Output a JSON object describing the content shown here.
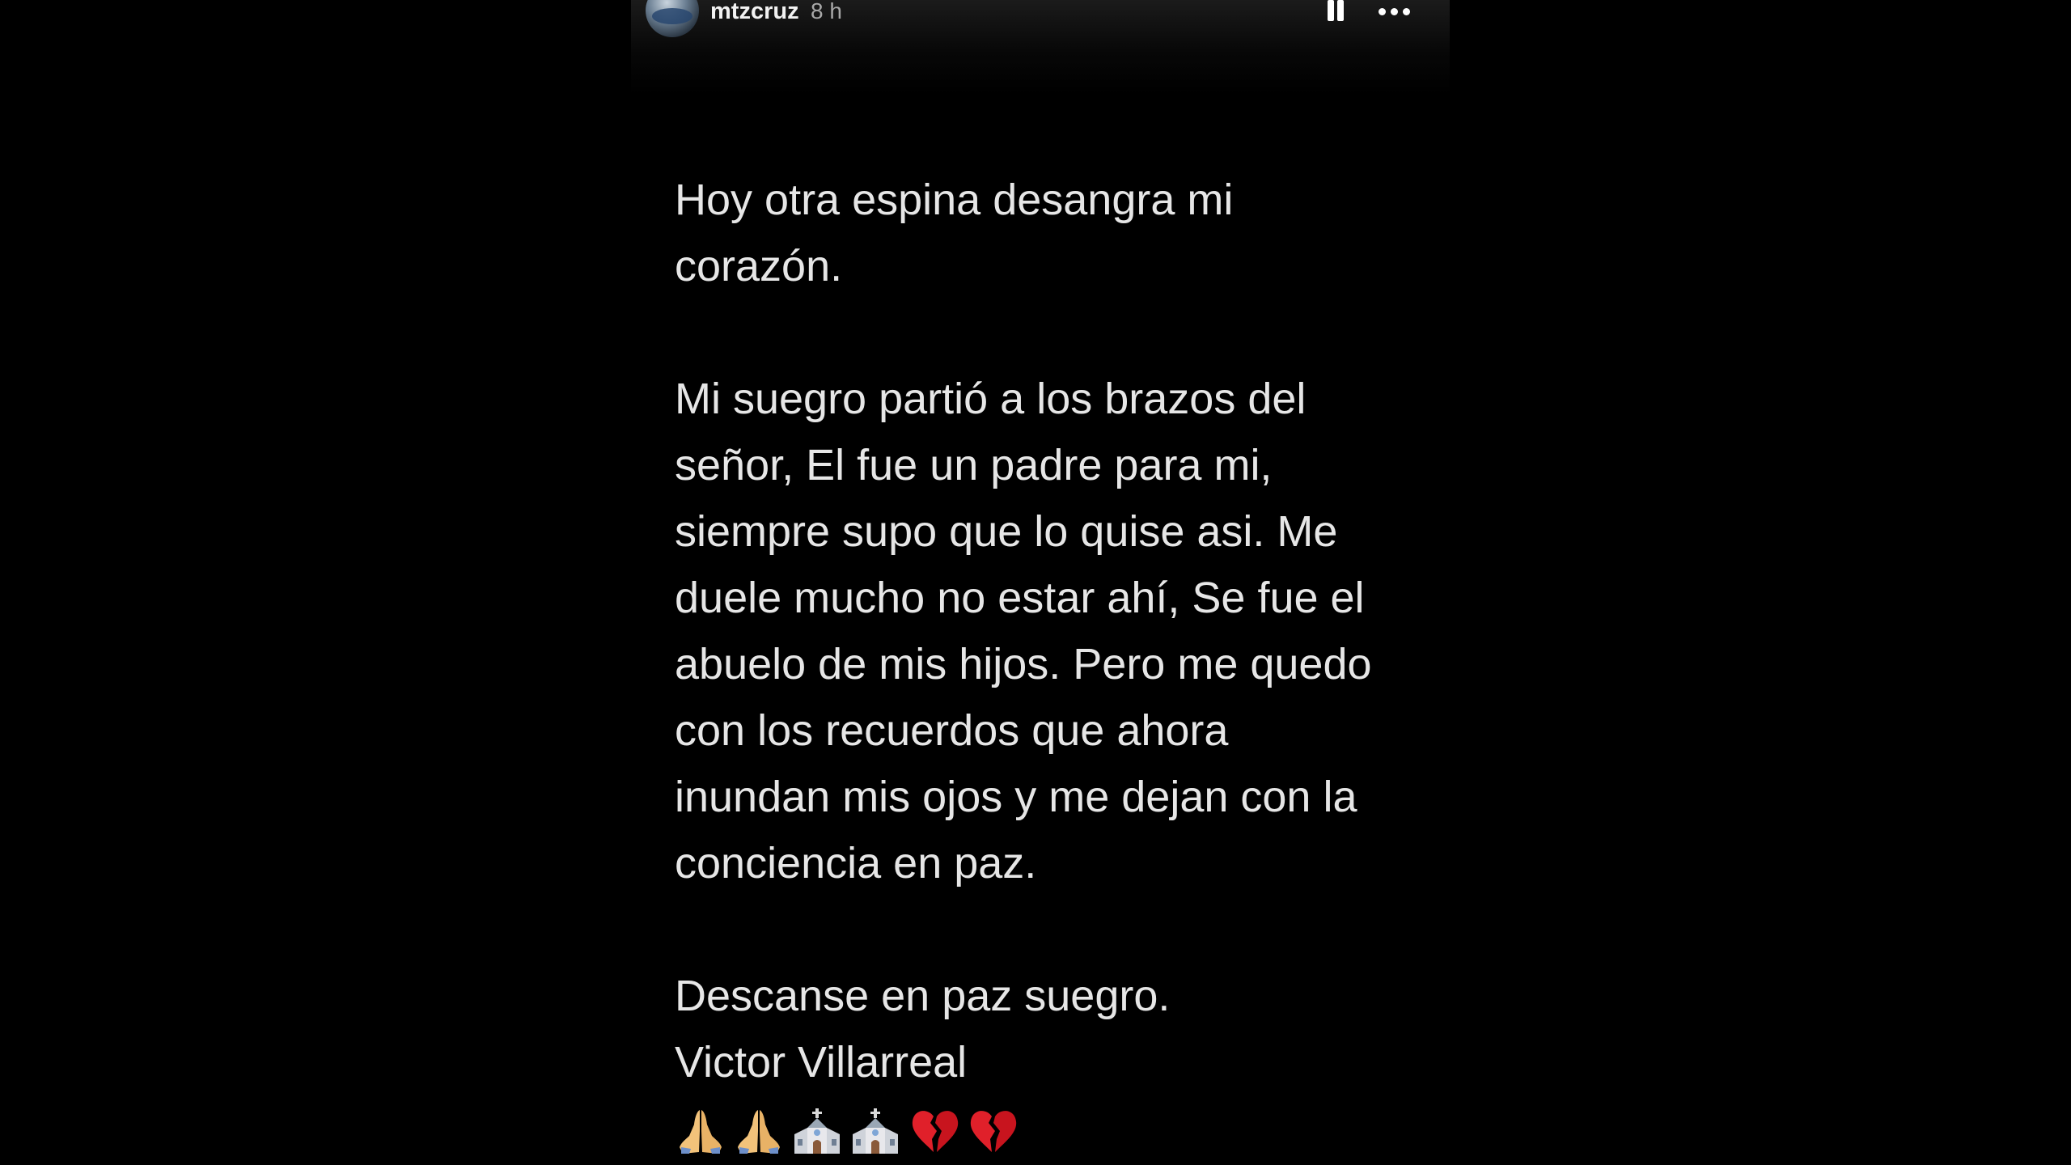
{
  "story": {
    "username": "mtzcruz",
    "timestamp": "8 h",
    "controls": {
      "pause_icon": "pause-icon",
      "more_icon": "more-options-icon"
    },
    "paragraphs": [
      {
        "lines": [
          "Hoy otra espina desangra mi",
          "corazón."
        ]
      },
      {
        "lines": [
          "Mi suegro partió a los brazos del",
          "señor, El fue un padre para mi,",
          "siempre supo que lo quise asi. Me",
          "duele mucho no estar ahí, Se fue el",
          "abuelo de mis hijos. Pero me quedo",
          "con los recuerdos que ahora",
          "inundan mis ojos y me dejan con la",
          "conciencia en paz."
        ]
      },
      {
        "lines": [
          "Descanse en paz suegro.",
          "Victor Villarreal"
        ]
      }
    ],
    "emojis": [
      "praying-hands",
      "praying-hands",
      "church",
      "church",
      "broken-heart",
      "broken-heart"
    ]
  },
  "colors": {
    "background": "#000000",
    "text": "#e6e6e6",
    "timestamp": "#a8a8a8",
    "icons": "#ffffff"
  }
}
